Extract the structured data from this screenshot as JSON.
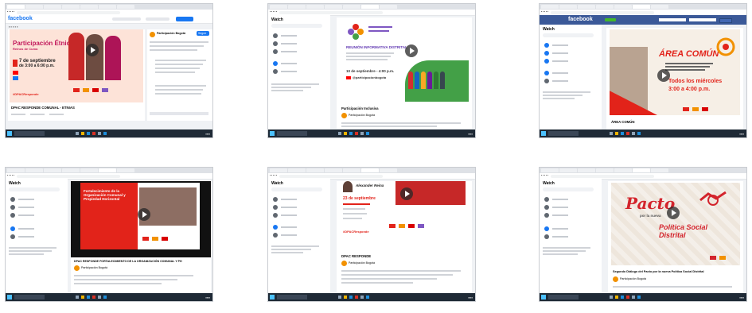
{
  "screens": [
    {
      "logo": "facebook",
      "video_title": "Participación Étnica",
      "video_subtitle": "Reinos de Cuma",
      "date_line": "7 de septiembre",
      "time_line": "de 3:00 a 6:00 p.m.",
      "hashtag": "#DPACResponde",
      "caption": "DPAC RESPONDE COMUNAL - ETNIAS",
      "comments_header": "Participación Bogotá",
      "follow_label": "Seguir"
    },
    {
      "section_title": "Watch",
      "event_title": "REUNIÓN INFORMATIVA DISTRITAL",
      "event_date": "10 de septiembre - 4:00 p.m.",
      "handle": "@participacionbogota",
      "caption": "Participación Inclusiva",
      "page_name": "Participación Bogotá"
    },
    {
      "logo": "facebook",
      "section_title": "Watch",
      "brand": "ÁREA COMÚN",
      "schedule_line1": "Todos los miércoles",
      "schedule_line2": "3:00 a 4:00 p.m.",
      "caption": "ÁREA COMÚN"
    },
    {
      "section_title": "Watch",
      "video_title": "Fortalecimiento de la Organización Comunal y Propiedad Horizontal",
      "caption": "DPAC RESPONDE FORTALECIMIENTO DE LA ORGANIZACIÓN COMUNAL Y PH",
      "page_name": "Participación Bogotá"
    },
    {
      "section_title": "Watch",
      "speaker": "Alexander Reina",
      "event_date": "23 de septiembre",
      "hashtag": "#DPACResponde",
      "caption": "DPAC RESPONDE",
      "page_name": "Participación Bogotá"
    },
    {
      "section_title": "Watch",
      "poster_line1": "Pacto",
      "poster_line2": "por la nueva",
      "poster_line3": "Política Social Distrital",
      "caption": "Segundo Diálogo del Pacto por la nueva Política Social Distrital",
      "page_name": "Participación Bogotá"
    }
  ],
  "taskbar": {
    "search_placeholder": "Escribe aquí para buscar",
    "clock": "4:00 p.m."
  },
  "colors": {
    "fb_blue": "#1877f2",
    "fb_dark_header": "#3b5998",
    "dpac_red": "#e2231a",
    "idpac_orange": "#f29100",
    "poster_red": "#d3242c"
  }
}
